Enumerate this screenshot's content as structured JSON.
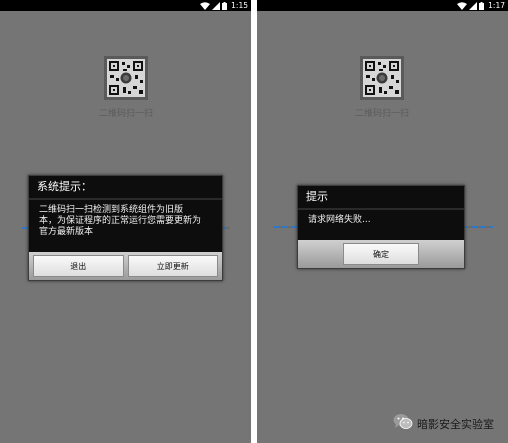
{
  "screens": [
    {
      "status_time": "1:15",
      "qr_caption": "二维码扫一扫",
      "dialog": {
        "title": "系统提示：",
        "message_lines": [
          "二维码扫一扫检测到系统组件为旧版",
          "本，为保证程序的正常运行您需要更新为",
          "官方最新版本"
        ],
        "buttons": [
          "退出",
          "立即更新"
        ]
      }
    },
    {
      "status_time": "1:17",
      "qr_caption": "二维码扫一扫",
      "dialog": {
        "title": "提示",
        "message_lines": [
          "请求网络失败..."
        ],
        "buttons": [
          "确定"
        ]
      }
    }
  ],
  "watermark": {
    "text": "暗影安全实验室",
    "icon": "wechat-icon"
  },
  "icons": {
    "status": [
      "wifi-icon",
      "signal-icon",
      "battery-icon"
    ]
  },
  "colors": {
    "background": "#757575",
    "status_bar": "#000000",
    "dialog": "#0d0d0d",
    "scan_line": "#2f78c8"
  }
}
